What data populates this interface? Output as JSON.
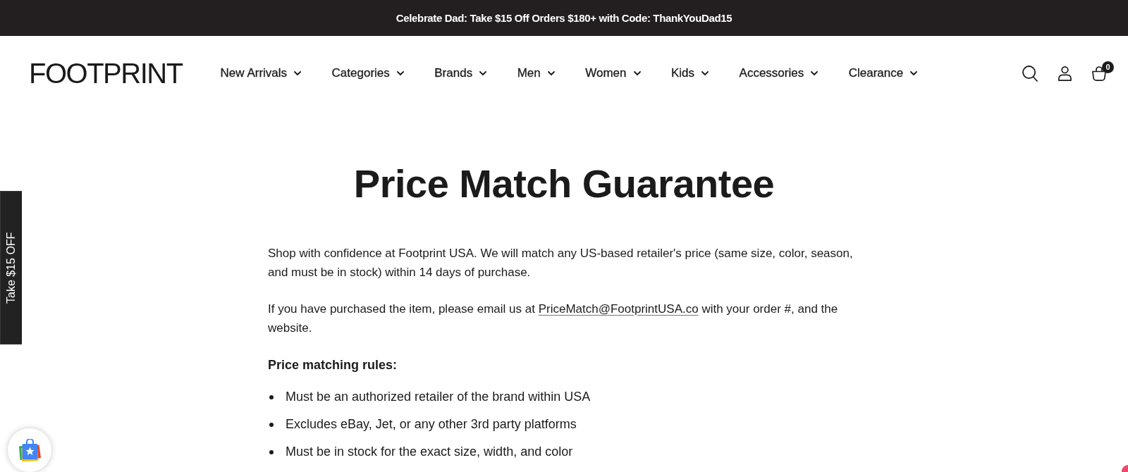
{
  "announcement_bar": {
    "text": "Celebrate Dad: Take $15 Off Orders $180+ with Code: ThankYouDad15"
  },
  "header": {
    "logo": "FOOTPRINT",
    "nav": [
      {
        "label": "New Arrivals"
      },
      {
        "label": "Categories"
      },
      {
        "label": "Brands"
      },
      {
        "label": "Men"
      },
      {
        "label": "Women"
      },
      {
        "label": "Kids"
      },
      {
        "label": "Accessories"
      },
      {
        "label": "Clearance"
      }
    ],
    "cart": {
      "count": "0"
    }
  },
  "page": {
    "title": "Price Match Guarantee",
    "paragraphs": [
      {
        "kind": "text",
        "text": "Shop with confidence at Footprint USA. We will match any US-based retailer's price (same size, color, season, and must be in stock) within 14 days of purchase."
      },
      {
        "kind": "link",
        "before": "If you have purchased the item, please email us at ",
        "link": "PriceMatch@FootprintUSA.co",
        "after": " with your order #, and the website."
      }
    ],
    "rules_heading": "Price matching rules:",
    "rules": [
      "Must be an authorized retailer of the brand within USA",
      "Excludes eBay, Jet, or any other 3rd party platforms",
      "Must be in stock for the exact size, width, and color"
    ]
  },
  "side_tab": {
    "label": "Take $15 OFF"
  }
}
